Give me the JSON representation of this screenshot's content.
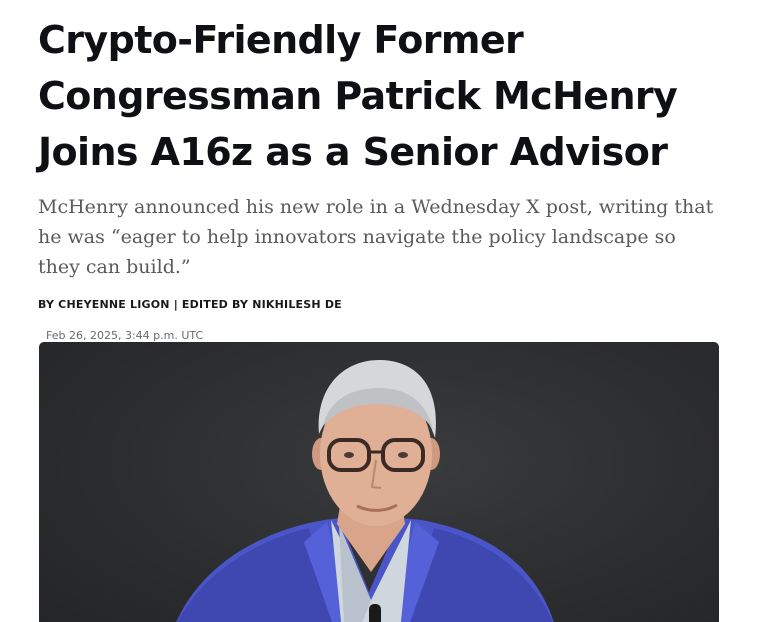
{
  "article": {
    "headline": "Crypto-Friendly Former Congressman Patrick McHenry Joins A16z as a Senior Advisor",
    "subheadline": "McHenry announced his new role in a Wednesday X post, writing that he was “eager to help innovators navigate the policy landscape so they can build.”",
    "byline": {
      "author": "By Cheyenne Ligon",
      "separator": "|",
      "editor": "Edited by Nikhilesh De"
    },
    "published": "Feb 26, 2025, 3:44 p.m. UTC"
  },
  "hero_image": {
    "subject": "portrait photo of Patrick McHenry"
  }
}
